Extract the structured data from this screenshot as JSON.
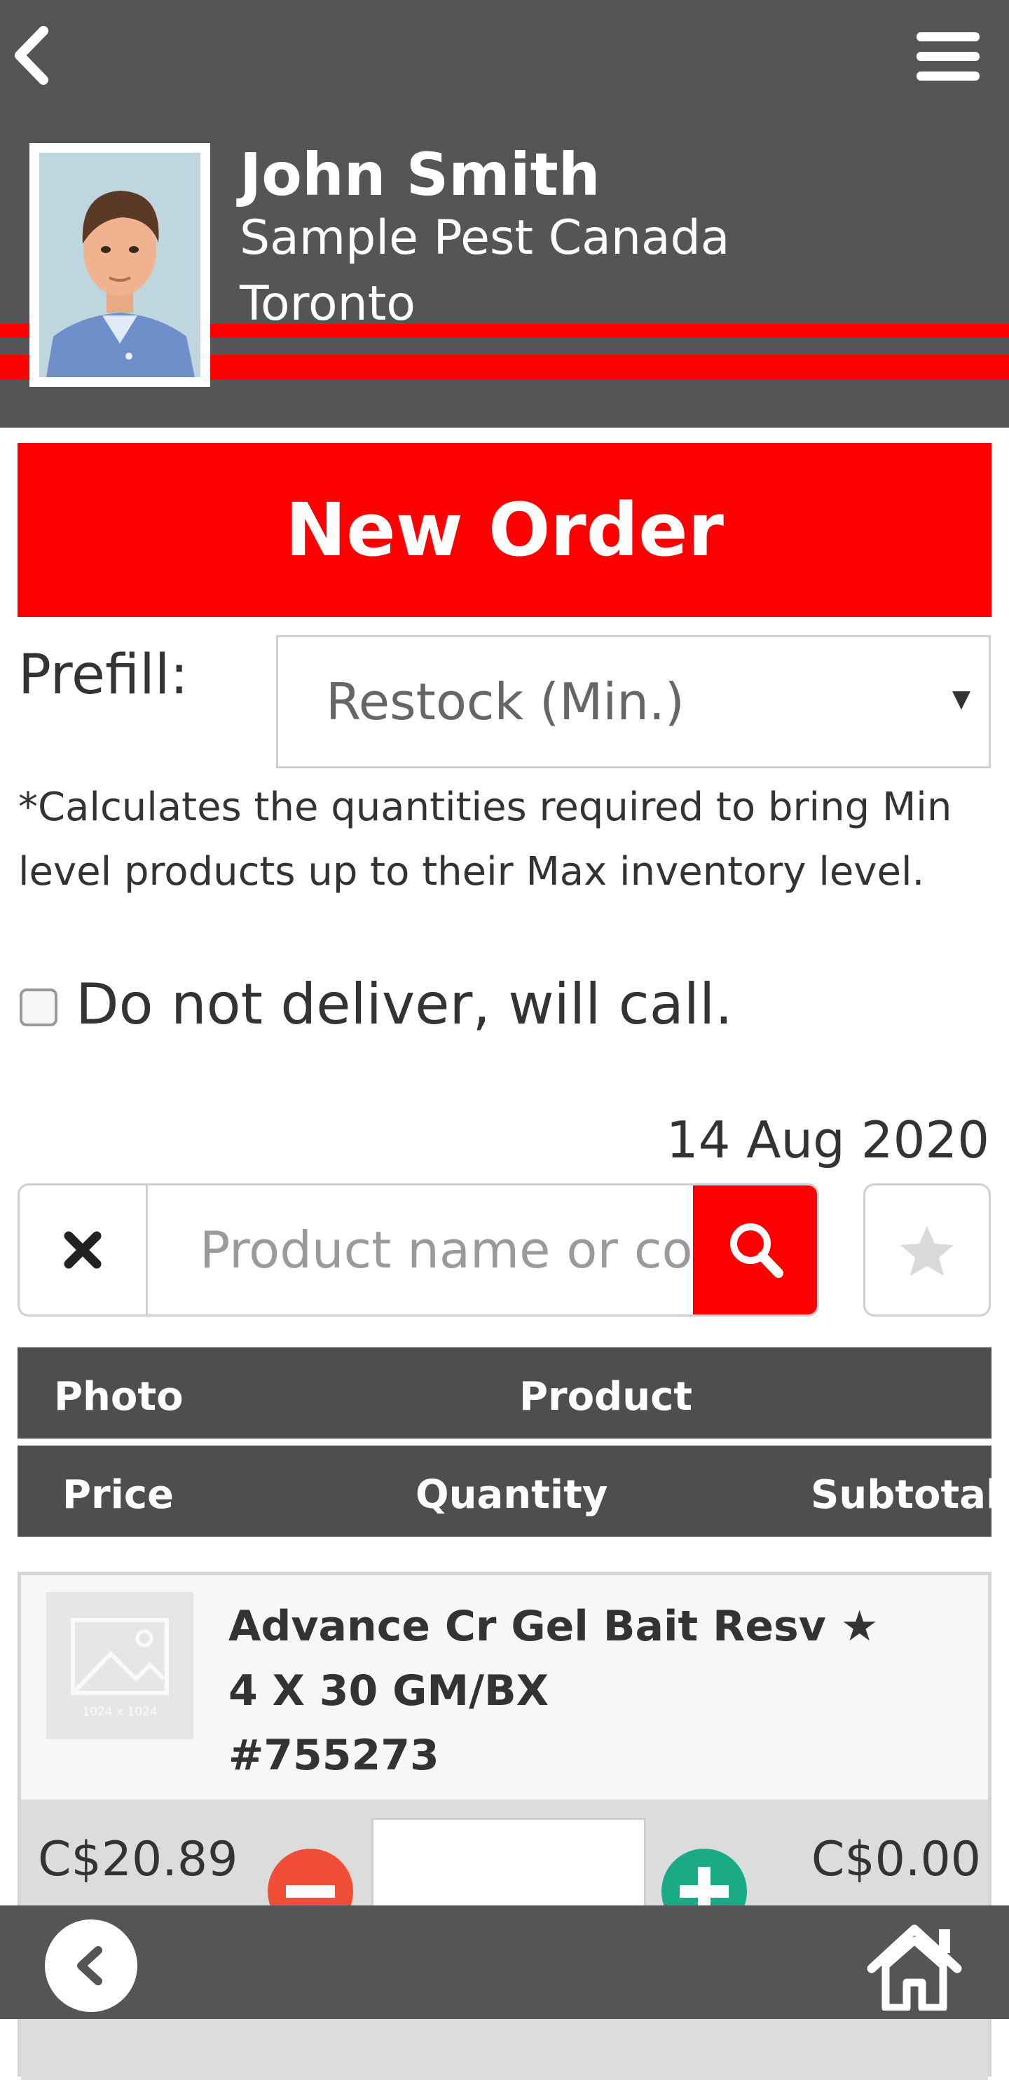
{
  "header": {
    "user_name": "John Smith",
    "company": "Sample Pest Canada",
    "city": "Toronto",
    "back_icon": "chevron-left-icon",
    "menu_icon": "hamburger-menu-icon"
  },
  "title": "New Order",
  "prefill": {
    "label": "Prefill:",
    "selected": "Restock (Min.)",
    "note": "*Calculates the quantities required to bring Min level products up to their Max inventory level."
  },
  "delivery": {
    "checkbox_label": "Do not deliver, will call.",
    "checked": false
  },
  "order_date": "14 Aug 2020",
  "search": {
    "placeholder": "Product name or co",
    "value": ""
  },
  "table": {
    "header_row1": [
      "Photo",
      "Product"
    ],
    "header_row2": [
      "Price",
      "Quantity",
      "Subtotal"
    ]
  },
  "products": [
    {
      "name": "Advance Cr Gel Bait Resv ★",
      "size": "4 X 30 GM/BX",
      "sku": "#755273",
      "thumb_label": "1024 x 1024",
      "price": "C$20.89",
      "quantity": "",
      "subtotal": "C$0.00"
    }
  ],
  "colors": {
    "brand_red": "#ff0000",
    "header_gray": "#555456",
    "table_header": "#4e4e4e",
    "minus": "#f04e37",
    "plus": "#1aaa85"
  }
}
